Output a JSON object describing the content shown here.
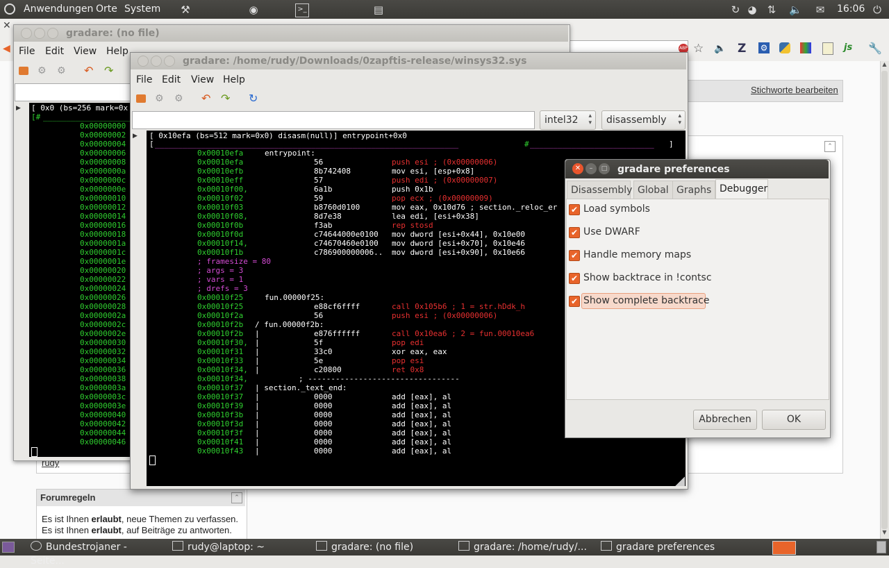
{
  "top_panel": {
    "menus": [
      "Anwendungen",
      "Orte",
      "System"
    ],
    "clock": "16:06"
  },
  "browser_bg": {
    "link_stichworte": "Stichworte bearbeiten",
    "user_link": "rudy",
    "forum_title": "Forumregeln",
    "forum_lines": [
      {
        "pre": "Es ist Ihnen ",
        "bold": "erlaubt",
        "post": ", neue Themen zu verfassen."
      },
      {
        "pre": "Es ist Ihnen ",
        "bold": "erlaubt",
        "post": ", auf Beiträge zu antworten."
      }
    ]
  },
  "window_back": {
    "title": "gradare: (no file)",
    "menu": [
      "File",
      "Edit",
      "View",
      "Help"
    ],
    "term_header": "[ 0x0 (bs=256 mark=0x",
    "term_header2": "[#",
    "addresses": [
      "0x00000000",
      "0x00000002",
      "0x00000004",
      "0x00000006",
      "0x00000008",
      "0x0000000a",
      "0x0000000c",
      "0x0000000e",
      "0x00000010",
      "0x00000012",
      "0x00000014",
      "0x00000016",
      "0x00000018",
      "0x0000001a",
      "0x0000001c",
      "0x0000001e",
      "0x00000020",
      "0x00000022",
      "0x00000024",
      "0x00000026",
      "0x00000028",
      "0x0000002a",
      "0x0000002c",
      "0x0000002e",
      "0x00000030",
      "0x00000032",
      "0x00000034",
      "0x00000036",
      "0x00000038",
      "0x0000003a",
      "0x0000003c",
      "0x0000003e",
      "0x00000040",
      "0x00000042",
      "0x00000044",
      "0x00000046"
    ]
  },
  "window_main": {
    "title": "gradare: /home/rudy/Downloads/0zapftis-release/winsys32.sys",
    "menu": [
      "File",
      "Edit",
      "View",
      "Help"
    ],
    "arch_select": "intel32",
    "mode_select": "disassembly",
    "term_header": "[ 0x10efa (bs=512 mark=0x0) disasm(null)] entrypoint+0x0",
    "term_header2_left": "[",
    "term_header2_mid": "#",
    "term_header2_right": "]",
    "lines": [
      {
        "addr": "0x00010efa",
        "label": "entrypoint:",
        "bytes": "",
        "instr": "",
        "cls": ""
      },
      {
        "addr": "0x00010efa",
        "label": "",
        "bytes": "56",
        "instr": "push esi ; (0x00000006)",
        "cls": "red"
      },
      {
        "addr": "0x00010efb",
        "label": "",
        "bytes": "8b742408",
        "instr": "mov esi, [esp+0x8]",
        "cls": "wh"
      },
      {
        "addr": "0x00010eff",
        "label": "",
        "bytes": "57",
        "instr": "push edi ; (0x00000007)",
        "cls": "red"
      },
      {
        "addr": "0x00010f00,",
        "label": "",
        "bytes": "6a1b",
        "instr": "push 0x1b",
        "cls": "wh"
      },
      {
        "addr": "0x00010f02",
        "label": "",
        "bytes": "59",
        "instr": "pop ecx ; (0x00000009)",
        "cls": "red"
      },
      {
        "addr": "0x00010f03",
        "label": "",
        "bytes": "b8760d0100",
        "instr": "mov eax, 0x10d76 ; section._reloc_er",
        "cls": "wh"
      },
      {
        "addr": "0x00010f08,",
        "label": "",
        "bytes": "8d7e38",
        "instr": "lea edi, [esi+0x38]",
        "cls": "wh"
      },
      {
        "addr": "0x00010f0b",
        "label": "",
        "bytes": "f3ab",
        "instr": "rep stosd",
        "cls": "red"
      },
      {
        "addr": "0x00010f0d",
        "label": "",
        "bytes": "c74644000e0100",
        "instr": "mov dword [esi+0x44], 0x10e00",
        "cls": "wh"
      },
      {
        "addr": "0x00010f14,",
        "label": "",
        "bytes": "c74670460e0100",
        "instr": "mov dword [esi+0x70], 0x10e46",
        "cls": "wh"
      },
      {
        "addr": "0x00010f1b",
        "label": "",
        "bytes": "c786900000006..",
        "instr": "mov dword [esi+0x90], 0x10e66",
        "cls": "wh"
      },
      {
        "addr": "; framesize = 80",
        "label": "",
        "bytes": "",
        "instr": "",
        "cls": "mag"
      },
      {
        "addr": "; args = 3",
        "label": "",
        "bytes": "",
        "instr": "",
        "cls": "mag"
      },
      {
        "addr": "; vars = 1",
        "label": "",
        "bytes": "",
        "instr": "",
        "cls": "mag"
      },
      {
        "addr": "; drefs = 3",
        "label": "",
        "bytes": "",
        "instr": "",
        "cls": "mag"
      },
      {
        "addr": "0x00010f25",
        "label": "fun.00000f25:",
        "bytes": "",
        "instr": "",
        "cls": ""
      },
      {
        "addr": "0x00010f25",
        "label": "",
        "bytes": "e88cf6ffff",
        "instr": "call 0x105b6 ; 1 = str.hDdk_h",
        "cls": "red"
      },
      {
        "addr": "0x00010f2a",
        "label": "",
        "bytes": "56",
        "instr": "push esi ; (0x00000006)",
        "cls": "red"
      },
      {
        "addr": "0x00010f2b",
        "label": "/ fun.00000f2b:",
        "bytes": "",
        "instr": "",
        "cls": ""
      },
      {
        "addr": "0x00010f2b",
        "label": "|",
        "bytes": "e876ffffff",
        "instr": "call 0x10ea6 ; 2 = fun.00010ea6",
        "cls": "red"
      },
      {
        "addr": "0x00010f30,",
        "label": "|",
        "bytes": "5f",
        "instr": "pop edi",
        "cls": "red"
      },
      {
        "addr": "0x00010f31",
        "label": "|",
        "bytes": "33c0",
        "instr": "xor eax, eax",
        "cls": "wh"
      },
      {
        "addr": "0x00010f33",
        "label": "|",
        "bytes": "5e",
        "instr": "pop esi",
        "cls": "red"
      },
      {
        "addr": "0x00010f34,",
        "label": "|",
        "bytes": "c20800",
        "instr": "ret 0x8",
        "cls": "red"
      },
      {
        "addr": "0x00010f34,",
        "label": "",
        "bytes": "",
        "instr": "; ---------------------------------",
        "cls": "wh"
      },
      {
        "addr": "0x00010f37",
        "label": "| section._text_end:",
        "bytes": "",
        "instr": "",
        "cls": ""
      },
      {
        "addr": "0x00010f37",
        "label": "|",
        "bytes": "0000",
        "instr": "add [eax], al",
        "cls": "wh"
      },
      {
        "addr": "0x00010f39",
        "label": "|",
        "bytes": "0000",
        "instr": "add [eax], al",
        "cls": "wh"
      },
      {
        "addr": "0x00010f3b",
        "label": "|",
        "bytes": "0000",
        "instr": "add [eax], al",
        "cls": "wh"
      },
      {
        "addr": "0x00010f3d",
        "label": "|",
        "bytes": "0000",
        "instr": "add [eax], al",
        "cls": "wh"
      },
      {
        "addr": "0x00010f3f",
        "label": "|",
        "bytes": "0000",
        "instr": "add [eax], al",
        "cls": "wh"
      },
      {
        "addr": "0x00010f41",
        "label": "|",
        "bytes": "0000",
        "instr": "add [eax], al",
        "cls": "wh"
      },
      {
        "addr": "0x00010f43",
        "label": "|",
        "bytes": "0000",
        "instr": "add [eax], al",
        "cls": "wh"
      }
    ]
  },
  "prefs": {
    "title": "gradare preferences",
    "tabs": [
      "Disassembly",
      "Global",
      "Graphs",
      "Debugger"
    ],
    "active_tab": "Debugger",
    "options": [
      "Load symbols",
      "Use DWARF",
      "Handle memory maps",
      "Show backtrace in !contsc",
      "Show complete backtrace"
    ],
    "cancel": "Abbrechen",
    "ok": "OK"
  },
  "taskbar": {
    "items": [
      "Bundestrojaner - Seite...",
      "rudy@laptop: ~",
      "gradare: (no file)",
      "gradare: /home/rudy/...",
      "gradare preferences"
    ]
  },
  "colors": {
    "accent": "#e8642a",
    "terminal_bg": "#000000",
    "address": "#2fcf2f"
  }
}
